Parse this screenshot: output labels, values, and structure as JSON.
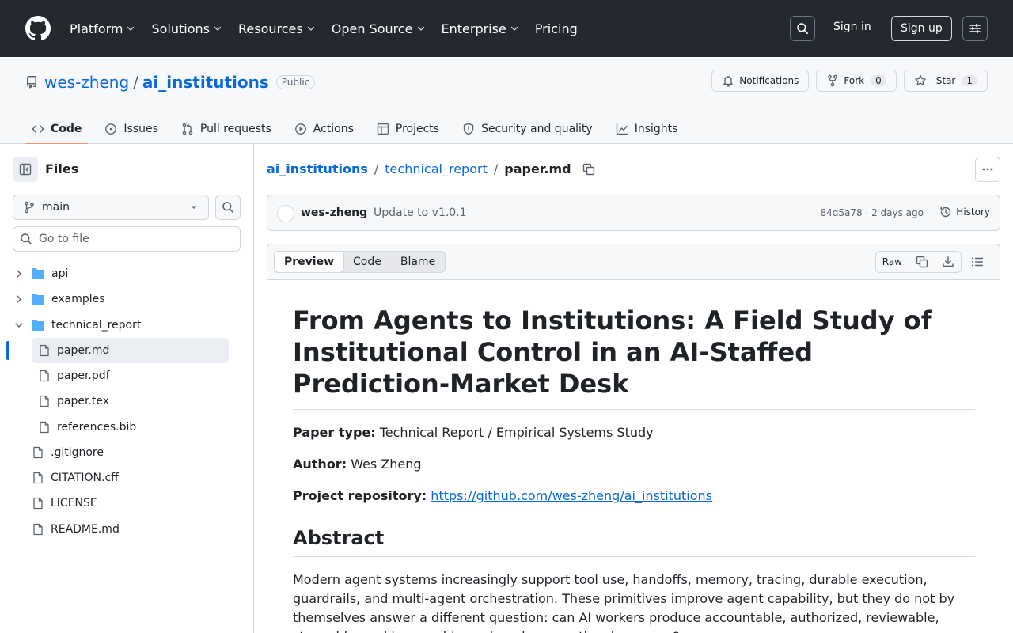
{
  "nav": {
    "items": [
      {
        "label": "Platform",
        "dropdown": true
      },
      {
        "label": "Solutions",
        "dropdown": true
      },
      {
        "label": "Resources",
        "dropdown": true
      },
      {
        "label": "Open Source",
        "dropdown": true
      },
      {
        "label": "Enterprise",
        "dropdown": true
      },
      {
        "label": "Pricing",
        "dropdown": false
      }
    ],
    "sign_in": "Sign in",
    "sign_up": "Sign up"
  },
  "repo": {
    "owner": "wes-zheng",
    "name": "ai_institutions",
    "visibility": "Public",
    "notifications_label": "Notifications",
    "fork_label": "Fork",
    "fork_count": "0",
    "star_label": "Star",
    "star_count": "1",
    "tabs": [
      {
        "label": "Code",
        "icon": "code-icon",
        "active": true
      },
      {
        "label": "Issues",
        "icon": "issue-icon",
        "active": false
      },
      {
        "label": "Pull requests",
        "icon": "pull-request-icon",
        "active": false
      },
      {
        "label": "Actions",
        "icon": "play-icon",
        "active": false
      },
      {
        "label": "Projects",
        "icon": "table-icon",
        "active": false
      },
      {
        "label": "Security and quality",
        "icon": "shield-icon",
        "active": false
      },
      {
        "label": "Insights",
        "icon": "graph-icon",
        "active": false
      }
    ]
  },
  "sidebar": {
    "title": "Files",
    "branch": "main",
    "goto_placeholder": "Go to file",
    "tree": [
      {
        "label": "api",
        "type": "folder",
        "depth": 0,
        "expanded": false
      },
      {
        "label": "examples",
        "type": "folder",
        "depth": 0,
        "expanded": false
      },
      {
        "label": "technical_report",
        "type": "folder",
        "depth": 0,
        "expanded": true
      },
      {
        "label": "paper.md",
        "type": "file",
        "depth": 1,
        "selected": true
      },
      {
        "label": "paper.pdf",
        "type": "file",
        "depth": 1
      },
      {
        "label": "paper.tex",
        "type": "file",
        "depth": 1
      },
      {
        "label": "references.bib",
        "type": "file",
        "depth": 1
      },
      {
        "label": ".gitignore",
        "type": "file",
        "depth": 0
      },
      {
        "label": "CITATION.cff",
        "type": "file",
        "depth": 0
      },
      {
        "label": "LICENSE",
        "type": "file",
        "depth": 0
      },
      {
        "label": "README.md",
        "type": "file",
        "depth": 0
      }
    ]
  },
  "breadcrumb": {
    "repo": "ai_institutions",
    "folder": "technical_report",
    "file": "paper.md"
  },
  "commit": {
    "author": "wes-zheng",
    "message": "Update to v1.0.1",
    "meta": "84d5a78 · 2 days ago",
    "history_label": "History"
  },
  "file_view": {
    "tabs": [
      "Preview",
      "Code",
      "Blame"
    ],
    "active_tab": "Preview",
    "raw_label": "Raw"
  },
  "paper": {
    "title": "From Agents to Institutions: A Field Study of Institutional Control in an AI-Staffed Prediction-Market Desk",
    "type_label": "Paper type:",
    "type_value": "Technical Report / Empirical Systems Study",
    "author_label": "Author:",
    "author_value": "Wes Zheng",
    "repo_label": "Project repository:",
    "repo_link": "https://github.com/wes-zheng/ai_institutions",
    "abstract_heading": "Abstract",
    "abstract_text": "Modern agent systems increasingly support tool use, handoffs, memory, tracing, durable execution, guardrails, and multi-agent orchestration. These primitives improve agent capability, but they do not by themselves answer a different question: can AI workers produce accountable, authorized, reviewable, stoppable, and improvable work under operational pressure?"
  },
  "colors": {
    "header_bg": "#24292f",
    "link": "#0969da",
    "tab_underline": "#fd8c73",
    "border": "#d0d7de"
  }
}
